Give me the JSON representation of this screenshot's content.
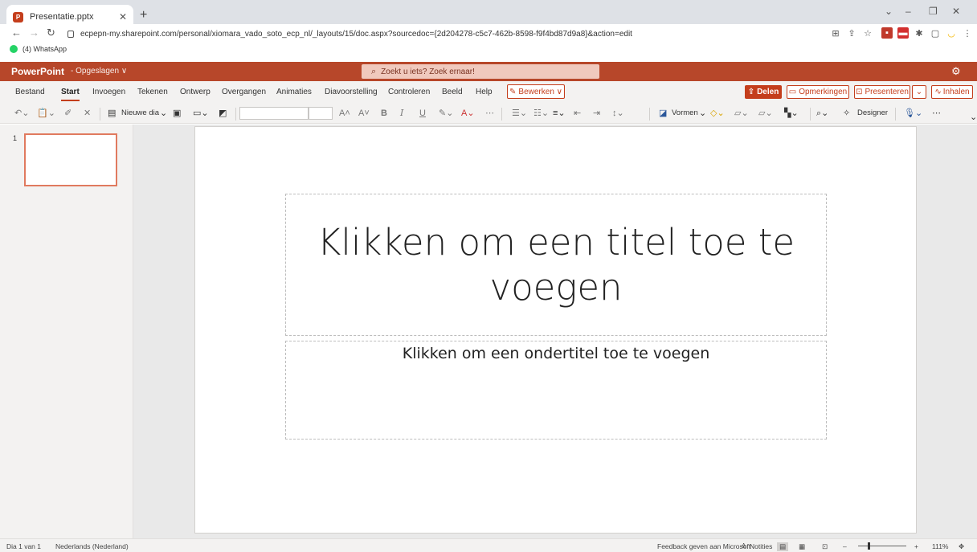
{
  "browser": {
    "tab_title": "Presentatie.pptx",
    "url": "ecpepn-my.sharepoint.com/personal/xiomara_vado_soto_ecp_nl/_layouts/15/doc.aspx?sourcedoc={2d204278-c5c7-462b-8598-f9f4bd87d9a8}&action=edit",
    "bookmark": "(4) WhatsApp"
  },
  "app": {
    "name": "PowerPoint",
    "save_status": "- Opgeslagen ∨",
    "search_placeholder": "Zoekt u iets? Zoek ernaar!"
  },
  "ribbon": {
    "tabs": [
      "Bestand",
      "Start",
      "Invoegen",
      "Tekenen",
      "Ontwerp",
      "Overgangen",
      "Animaties",
      "Diavoorstelling",
      "Controleren",
      "Beeld",
      "Help"
    ],
    "active_tab": "Start",
    "edit_mode": "Bewerken ∨",
    "share": "Delen",
    "comments": "Opmerkingen",
    "present": "Presenteren",
    "catch_up": "Inhalen"
  },
  "toolbar": {
    "new_slide": "Nieuwe dia",
    "shapes": "Vormen",
    "designer": "Designer"
  },
  "thumbnails": [
    {
      "number": "1"
    }
  ],
  "slide": {
    "title_placeholder": "Klikken om een titel toe te voegen",
    "subtitle_placeholder": "Klikken om een ondertitel toe te voegen"
  },
  "status": {
    "slide_count": "Dia 1 van 1",
    "language": "Nederlands (Nederland)",
    "feedback": "Feedback geven aan Microsoft",
    "notes": "Notities",
    "zoom": "111%"
  },
  "colors": {
    "accent": "#b7472a",
    "accent_bright": "#c43e1c"
  }
}
